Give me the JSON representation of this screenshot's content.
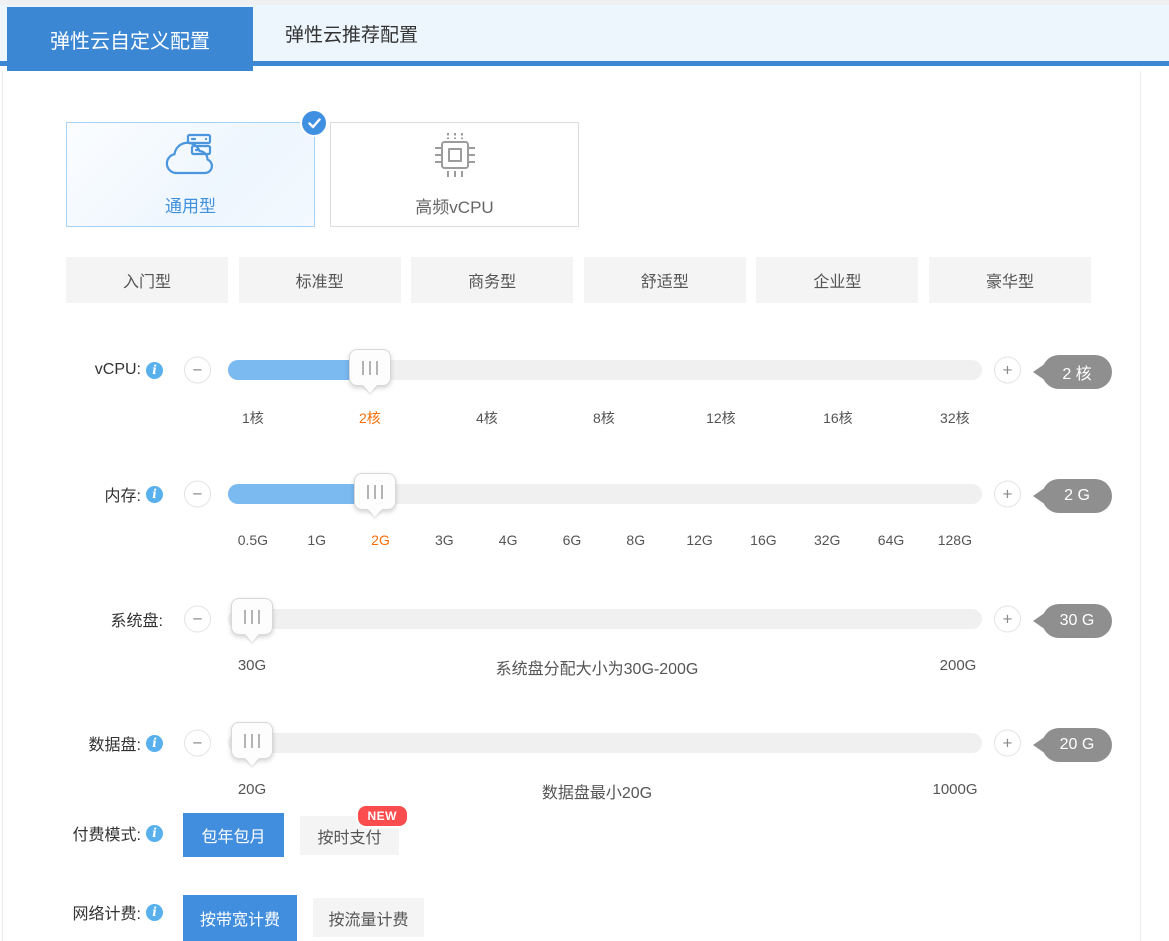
{
  "tabs": [
    {
      "label": "弹性云自定义配置",
      "active": true
    },
    {
      "label": "弹性云推荐配置",
      "active": false
    }
  ],
  "cards": [
    {
      "label": "通用型",
      "icon": "cloud-server-icon",
      "selected": true
    },
    {
      "label": "高频vCPU",
      "icon": "cpu-chip-icon",
      "selected": false
    }
  ],
  "tiers": [
    "入门型",
    "标准型",
    "商务型",
    "舒适型",
    "企业型",
    "豪华型"
  ],
  "sliders": [
    {
      "id": "vcpu",
      "label": "vCPU:",
      "has_info": true,
      "value": "2 核",
      "ticks": [
        "1核",
        "2核",
        "4核",
        "8核",
        "12核",
        "16核",
        "32核"
      ],
      "selected_tick": "2核",
      "fill_percent": 18.8,
      "thumb_percent": 18.8
    },
    {
      "id": "memory",
      "label": "内存:",
      "has_info": true,
      "value": "2 G",
      "ticks": [
        "0.5G",
        "1G",
        "2G",
        "3G",
        "4G",
        "6G",
        "8G",
        "12G",
        "16G",
        "32G",
        "64G",
        "128G"
      ],
      "selected_tick": "2G",
      "fill_percent": 19.5,
      "thumb_percent": 19.5
    },
    {
      "id": "sysdisk",
      "label": "系统盘:",
      "has_info": false,
      "value": "30 G",
      "min_label": "30G",
      "hint": "系统盘分配大小为30G-200G",
      "max_label": "200G",
      "fill_percent": 0,
      "thumb_percent": 3.2
    },
    {
      "id": "datadisk",
      "label": "数据盘:",
      "has_info": true,
      "value": "20 G",
      "min_label": "20G",
      "hint": "数据盘最小20G",
      "max_label": "1000G",
      "fill_percent": 0,
      "thumb_percent": 3.2
    }
  ],
  "payment": {
    "label": "付费模式:",
    "options": [
      {
        "label": "包年包月",
        "active": true
      },
      {
        "label": "按时支付",
        "active": false,
        "badge": "NEW"
      }
    ]
  },
  "network": {
    "label": "网络计费:",
    "options": [
      {
        "label": "按带宽计费",
        "active": true
      },
      {
        "label": "按流量计费",
        "active": false
      }
    ]
  },
  "colors": {
    "accent_blue": "#3b87d4",
    "button_blue": "#418ede",
    "slider_fill": "#7abaf1",
    "track_gray": "#f0f0f0",
    "badge_gray": "#8f8f8f",
    "selected_tick_orange": "#f5700a",
    "info_icon_blue": "#58b0ec",
    "new_badge_red": "#fb4d4d",
    "selected_card_border": "#a9d3f6"
  }
}
